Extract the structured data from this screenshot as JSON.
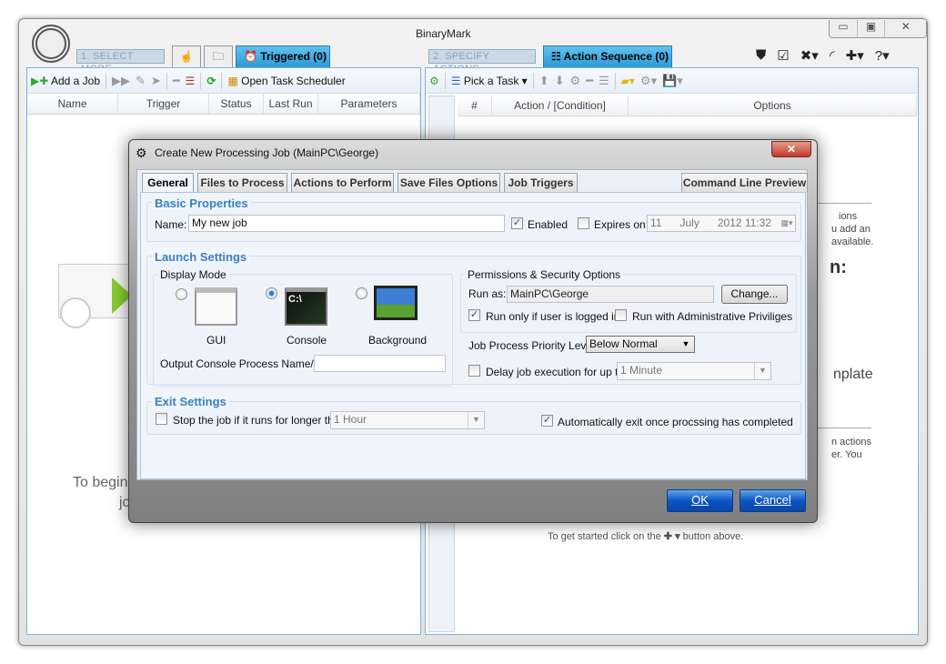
{
  "app": {
    "brand": "BinaryMark",
    "window_controls": [
      "minimize",
      "restore",
      "close"
    ]
  },
  "left": {
    "step_label": "1. SELECT MODE",
    "active_tab": "Triggered (0)",
    "toolbar": {
      "add_job": "Add a Job",
      "open_scheduler": "Open Task Scheduler"
    },
    "columns": [
      "Name",
      "Trigger",
      "Status",
      "Last Run",
      "Parameters"
    ],
    "empty_line1": "To begin",
    "empty_line2": "job"
  },
  "right": {
    "step_label": "2. SPECIFY ACTIONS",
    "active_tab": "Action Sequence (0)",
    "toolbar": {
      "pick_task": "Pick a Task"
    },
    "columns": [
      "#",
      "Action / [Condition]",
      "Options"
    ],
    "ghost": {
      "l1": "ions",
      "l2": "u add an",
      "l3": "available.",
      "h1": "n:",
      "h2": "nplate",
      "l4": "n actions",
      "l5": "er. You",
      "start_pre": "To get started click on the",
      "start_post": "button above."
    }
  },
  "dialog": {
    "title": "Create New Processing Job (MainPC\\George)",
    "tabs": [
      "General",
      "Files to Process",
      "Actions to Perform",
      "Save Files Options",
      "Job Triggers"
    ],
    "preview_tab": "Command Line Preview",
    "basic": {
      "title": "Basic Properties",
      "name_label": "Name:",
      "name_value": "My new job",
      "enabled_label": "Enabled",
      "enabled": true,
      "expires_label": "Expires on:",
      "expires": false,
      "date_day": "11",
      "date_month": "July",
      "date_rest": "2012 11:32"
    },
    "launch": {
      "title": "Launch Settings",
      "display_mode": "Display Mode",
      "modes": [
        "GUI",
        "Console",
        "Background"
      ],
      "selected_mode": "Console",
      "output_label": "Output Console Process Name/ID:",
      "output_value": "",
      "perm_title": "Permissions & Security Options",
      "run_as_label": "Run as:",
      "run_as_value": "MainPC\\George",
      "change": "Change...",
      "logged_in_label": "Run only if user is logged in",
      "logged_in": true,
      "admin_label": "Run with Administrative Priviliges",
      "admin": false,
      "priority_label": "Job Process Priority Level:",
      "priority_value": "Below Normal",
      "delay_label": "Delay job execution for up to:",
      "delay": false,
      "delay_value": "1 Minute"
    },
    "exit": {
      "title": "Exit Settings",
      "stop_label": "Stop the job if it runs for longer than:",
      "stop": false,
      "stop_value": "1 Hour",
      "auto_label": "Automatically exit once procssing has completed",
      "auto": true
    },
    "ok": "OK",
    "cancel": "Cancel"
  }
}
